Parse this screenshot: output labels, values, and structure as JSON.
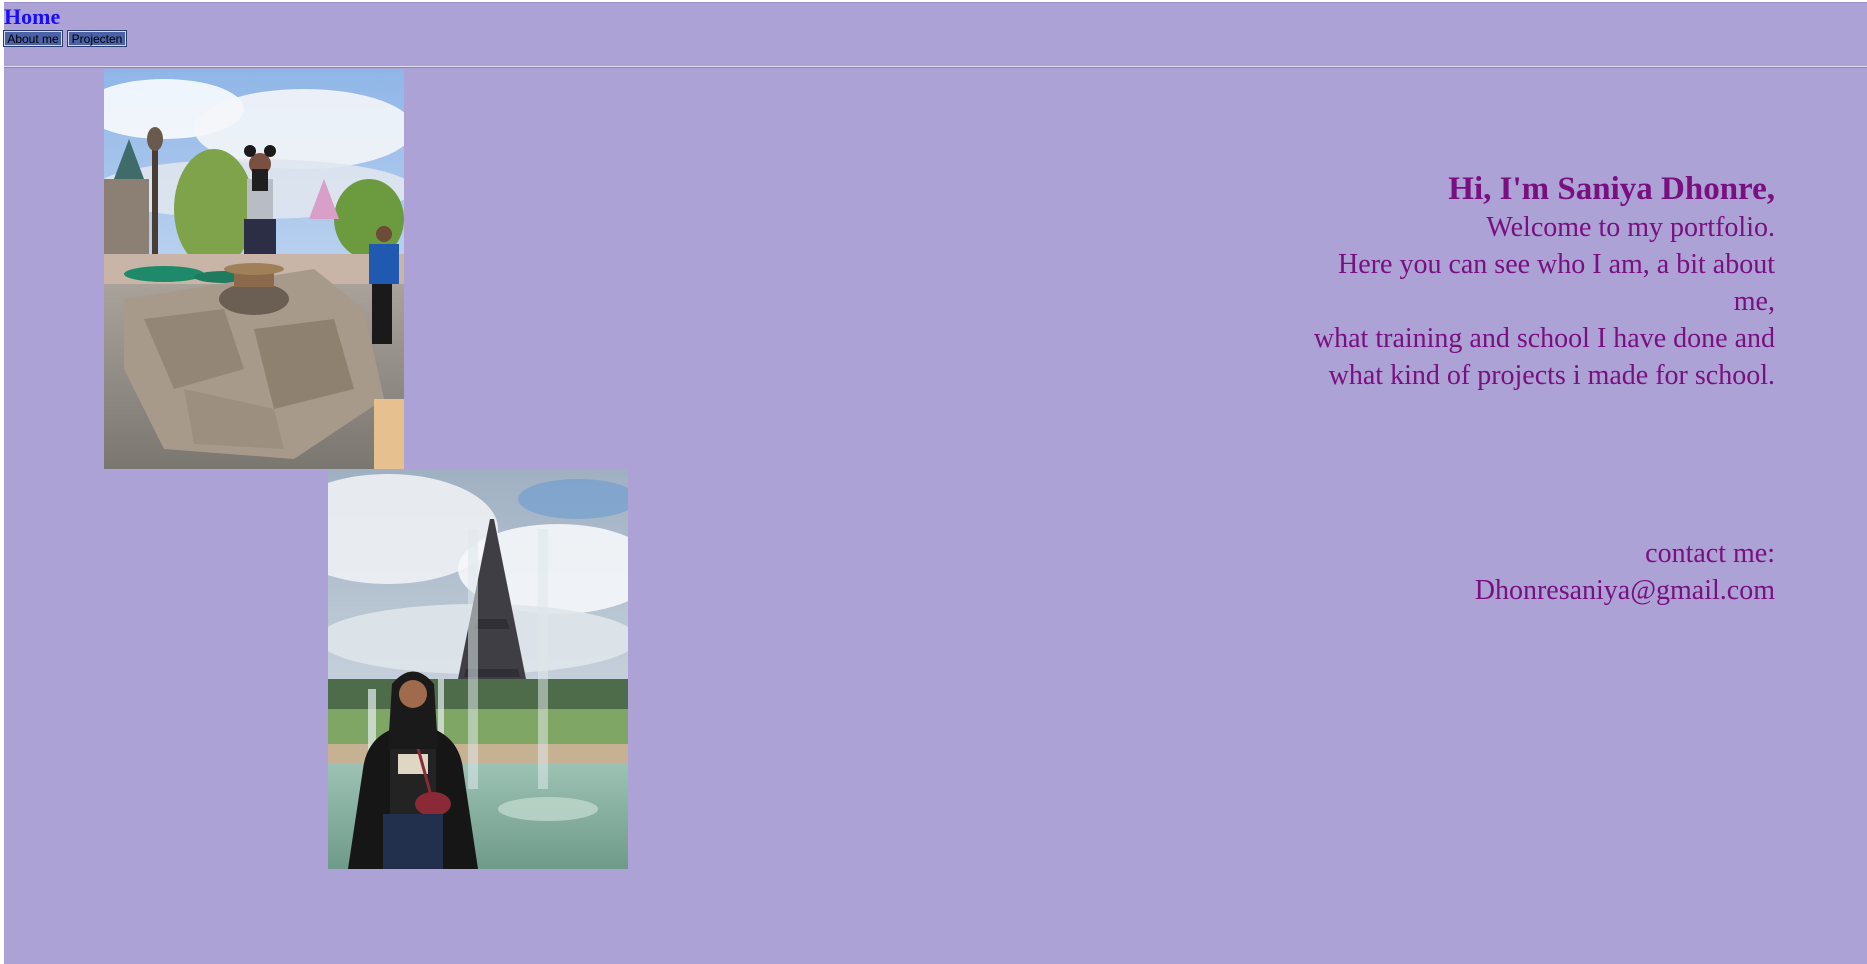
{
  "header": {
    "home_label": "Home",
    "nav": [
      {
        "label": "About me"
      },
      {
        "label": "Projecten"
      }
    ]
  },
  "intro": {
    "greeting": "Hi, I'm Saniya Dhonre,",
    "lines": [
      "Welcome to my portfolio.",
      "Here you can see who I am, a bit about me,",
      "what training and school I have done and",
      "what kind of projects i made for school."
    ]
  },
  "contact": {
    "label": "contact me:",
    "email": "Dhonresaniya@gmail.com"
  },
  "colors": {
    "page_background": "#aca2d6",
    "text_accent": "#7a0f80",
    "link": "#1a0dff",
    "nav_button": "#4b62a6"
  }
}
